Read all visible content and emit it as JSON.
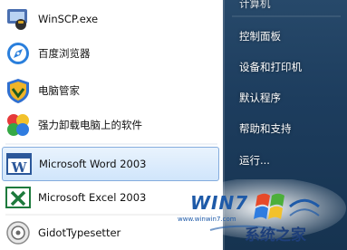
{
  "start_menu": {
    "programs": [
      {
        "label": "WinSCP.exe",
        "icon": "winscp-icon"
      },
      {
        "label": "百度浏览器",
        "icon": "baidu-browser-icon"
      },
      {
        "label": "电脑管家",
        "icon": "pc-manager-icon"
      },
      {
        "label": "强力卸载电脑上的软件",
        "icon": "uninstall-icon"
      },
      {
        "label": "Microsoft Word 2003",
        "icon": "word-icon"
      },
      {
        "label": "Microsoft Excel 2003",
        "icon": "excel-icon"
      },
      {
        "label": "GidotTypesetter",
        "icon": "gidot-icon"
      }
    ],
    "right_items": [
      {
        "label": "计算机"
      },
      {
        "label": "控制面板"
      },
      {
        "label": "设备和打印机"
      },
      {
        "label": "默认程序"
      },
      {
        "label": "帮助和支持"
      },
      {
        "label": "运行..."
      }
    ]
  },
  "watermark": {
    "logo_text": "WIN7",
    "site_text": "系统之家",
    "url": "www.winwin7.com"
  },
  "colors": {
    "selected_border": "#84acdd",
    "right_pane": "#1d3d5e",
    "watermark_blue": "#1e5aa8"
  }
}
